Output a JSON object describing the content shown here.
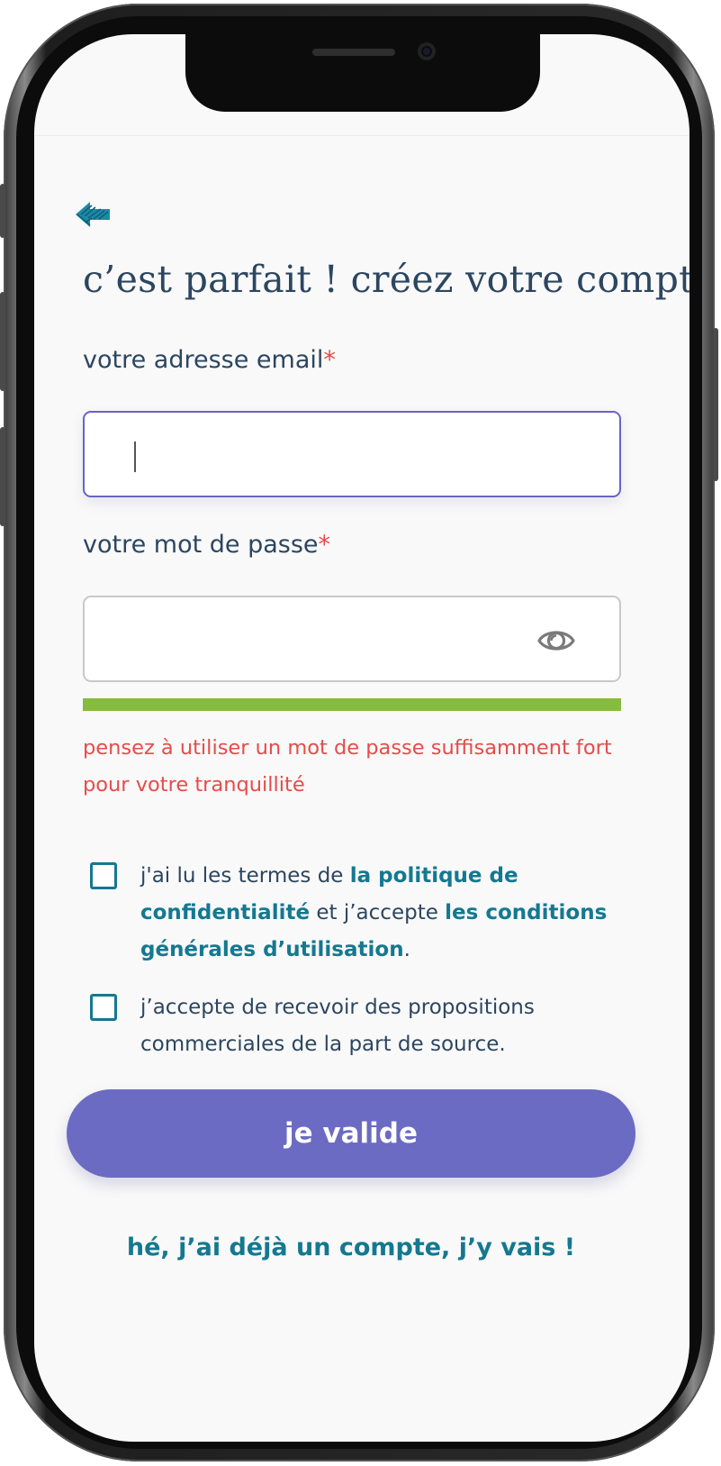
{
  "colors": {
    "accent": "#6b6bc3",
    "link": "#147890",
    "text": "#2c4660",
    "error": "#e74b4b",
    "strength_bar": "#85bc3c"
  },
  "header": {
    "back_icon": "back-arrow-icon",
    "title": "c’est parfait ! créez votre compte"
  },
  "form": {
    "email": {
      "label": "votre adresse email",
      "required_mark": "*",
      "value": "",
      "placeholder": ""
    },
    "password": {
      "label": "votre mot de passe",
      "required_mark": "*",
      "value": "",
      "placeholder": "",
      "visibility_icon": "eye-icon",
      "strength_level": 1.0,
      "hint": "pensez à utiliser un mot de passe suffisamment fort pour votre tranquillité"
    },
    "consents": [
      {
        "checked": false,
        "text_1": "j'ai lu les termes de ",
        "link_1": "la politique de confidentialité",
        "text_2": " et j’accepte ",
        "link_2": "les conditions générales d’utilisation",
        "text_3": "."
      },
      {
        "checked": false,
        "text": "j’accepte de recevoir des propositions commerciales de la part de source."
      }
    ],
    "submit_label": "je valide",
    "login_link": "hé, j’ai déjà un compte, j’y vais !"
  }
}
